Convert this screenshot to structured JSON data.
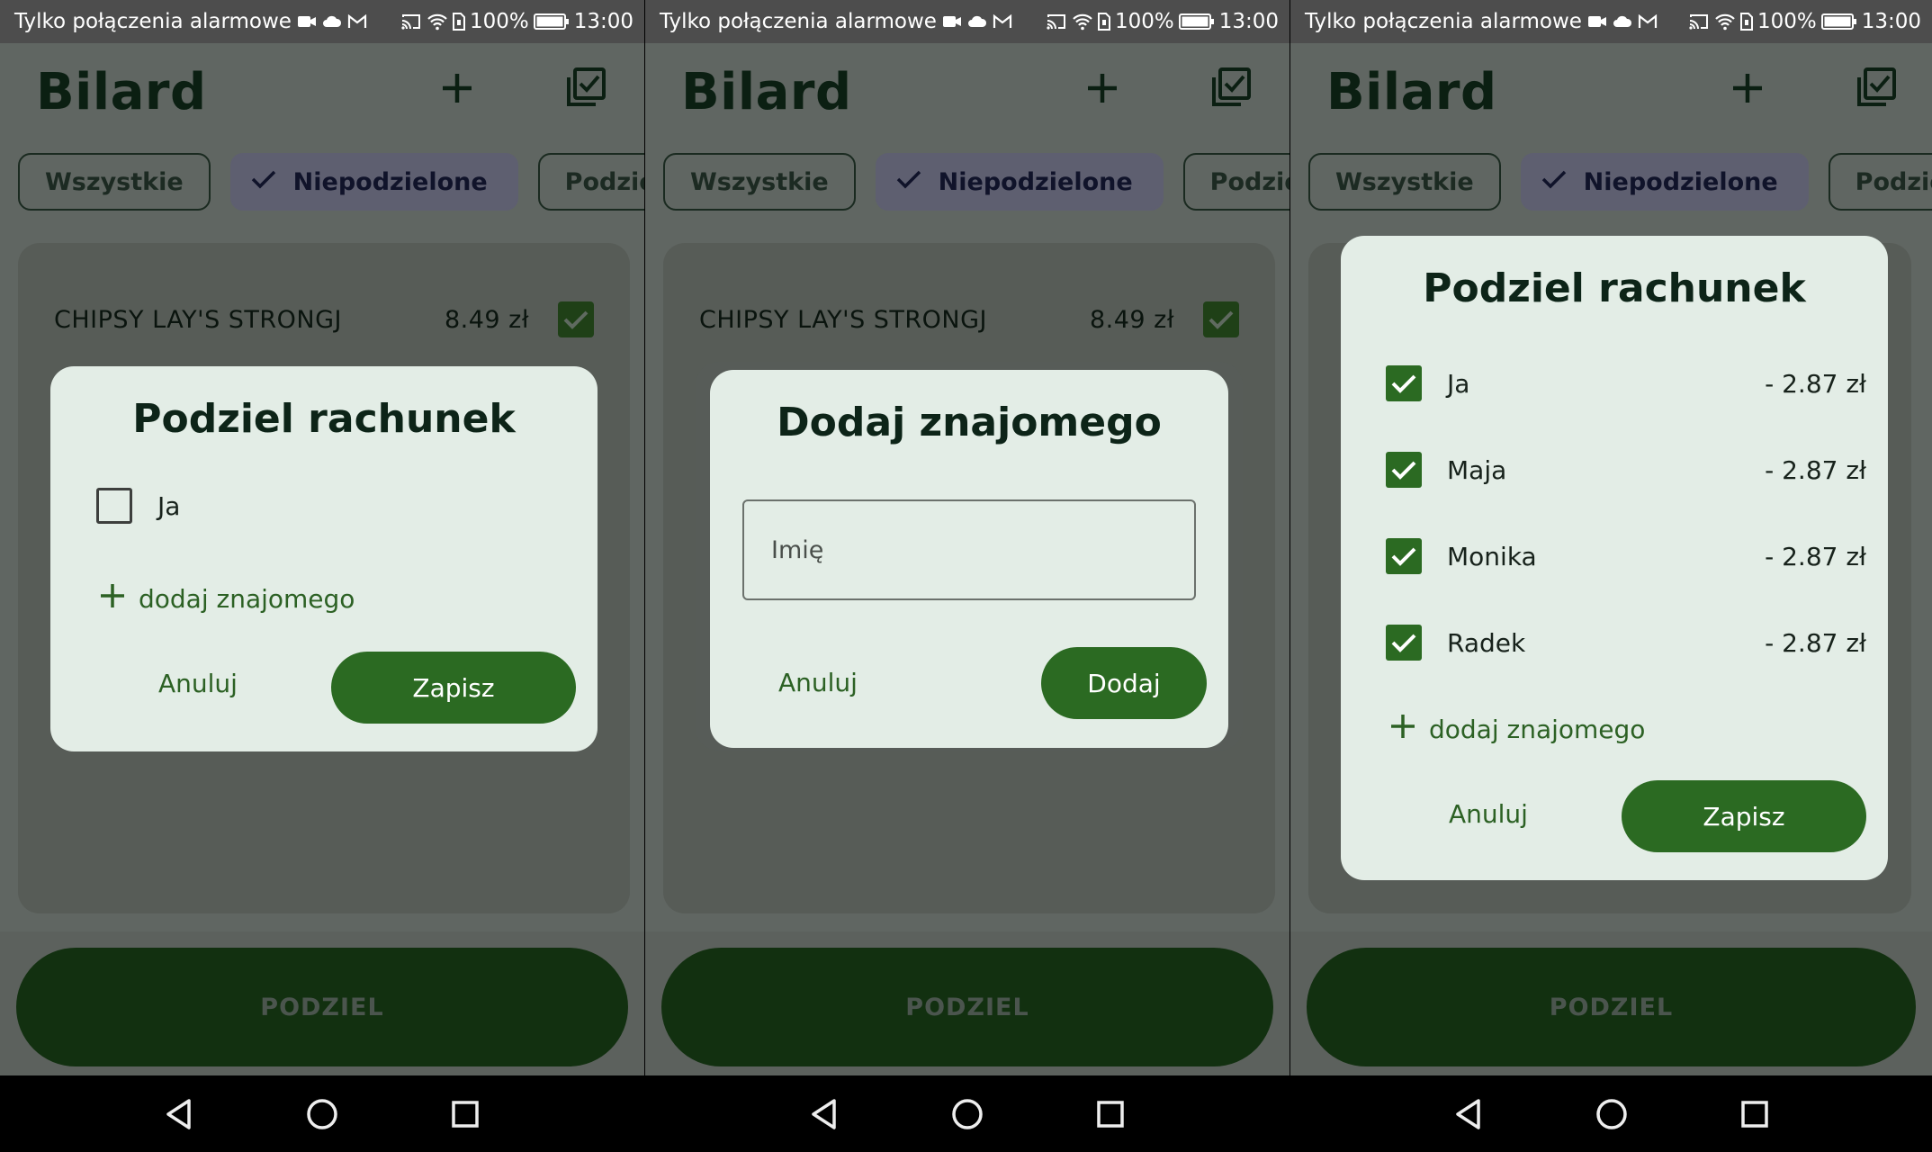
{
  "status_bar": {
    "carrier": "Tylko połączenia alarmowe",
    "battery": "100%",
    "time": "13:00"
  },
  "app": {
    "title": "Bilard",
    "filters": [
      "Wszystkie",
      "Niepodzielone",
      "Podzielone"
    ],
    "selected_filter": "Niepodzielone"
  },
  "item": {
    "name": "CHIPSY LAY'S STRONGJ",
    "price": "8.49 zł",
    "checked": true
  },
  "split_button": "PODZIEL",
  "screen1_dialog": {
    "title": "Podziel rachunek",
    "friends": [
      {
        "name": "Ja",
        "checked": false
      }
    ],
    "add_friend": "dodaj znajomego",
    "cancel": "Anuluj",
    "save": "Zapisz"
  },
  "screen2_dialog": {
    "title": "Dodaj znajomego",
    "input_placeholder": "Imię",
    "cancel": "Anuluj",
    "confirm": "Dodaj"
  },
  "screen3_dialog": {
    "title": "Podziel rachunek",
    "friends": [
      {
        "name": "Ja",
        "amount": "- 2.87 zł",
        "checked": true
      },
      {
        "name": "Maja",
        "amount": "- 2.87 zł",
        "checked": true
      },
      {
        "name": "Monika",
        "amount": "- 2.87 zł",
        "checked": true
      },
      {
        "name": "Radek",
        "amount": "- 2.87 zł",
        "checked": true
      }
    ],
    "add_friend": "dodaj znajomego",
    "cancel": "Anuluj",
    "save": "Zapisz"
  },
  "colors": {
    "primary": "#2b6a22",
    "dialog_bg": "#e3ede6",
    "scrim_bg": "#606662",
    "split_button_bg": "#123010"
  },
  "icons": {
    "status": [
      "video-icon",
      "cloud-icon",
      "gmail-icon",
      "cast-icon",
      "wifi-icon",
      "sim-icon",
      "battery-icon"
    ],
    "app_bar": [
      "add-icon",
      "select-all-icon"
    ],
    "nav": [
      "back-icon",
      "home-icon",
      "recents-icon"
    ]
  }
}
